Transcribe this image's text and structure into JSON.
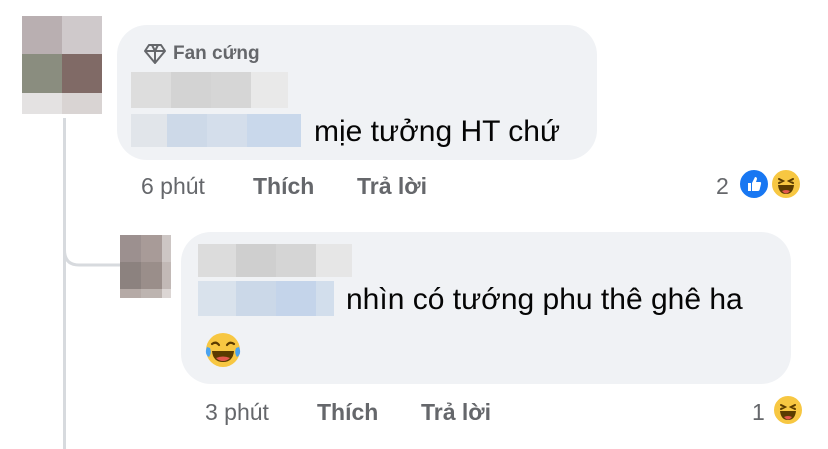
{
  "comment": {
    "badge": "Fan cứng",
    "text": "mịe tưởng HT chứ",
    "time": "6 phút",
    "like_label": "Thích",
    "reply_label": "Trả lời",
    "reaction_count": "2",
    "reactions": [
      "like-icon",
      "haha-icon"
    ]
  },
  "reply": {
    "text": "nhìn có tướng phu thê ghê ha",
    "emoji": "😂",
    "time": "3 phút",
    "like_label": "Thích",
    "reply_label": "Trả lời",
    "reaction_count": "1",
    "reactions": [
      "haha-icon"
    ]
  },
  "colors": {
    "bubble": "#f0f2f5",
    "meta_text": "#65676b",
    "like_blue": "#1877f2",
    "haha_yellow": "#f7c742"
  }
}
